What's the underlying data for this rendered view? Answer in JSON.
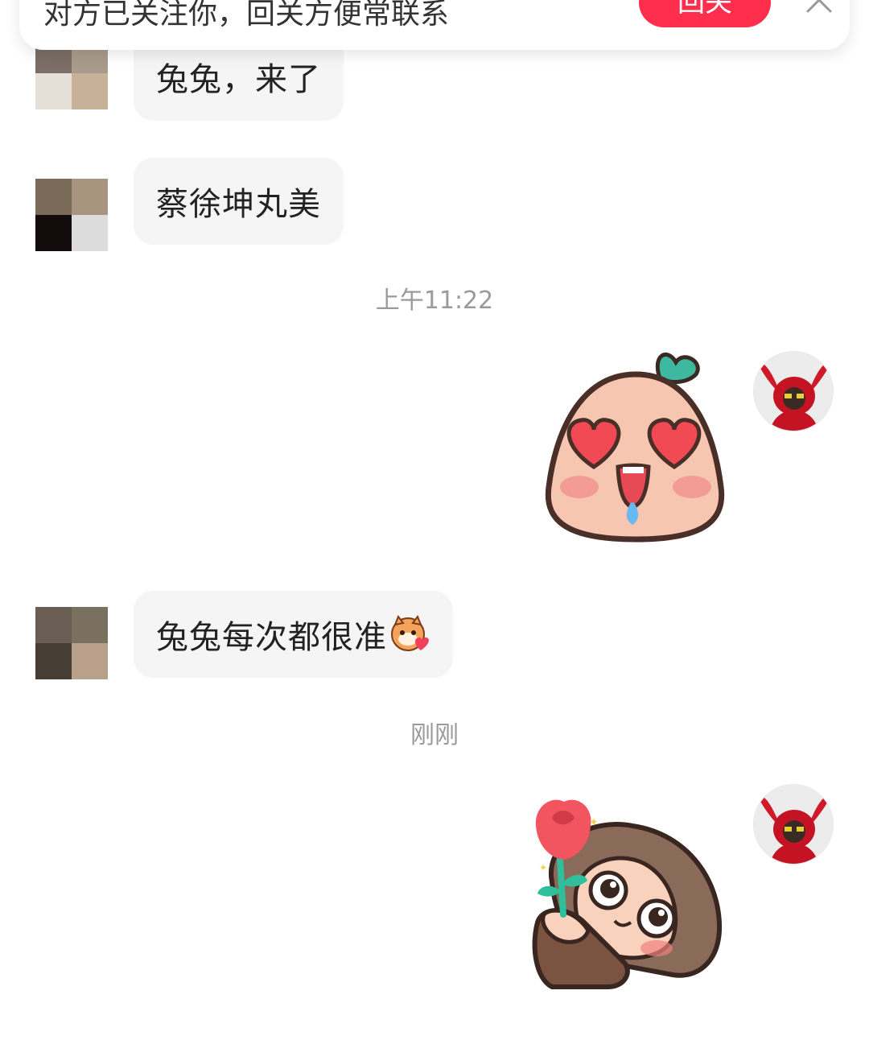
{
  "banner": {
    "text": "对方已关注你，回关方便常联系",
    "button_label": "回关",
    "close_icon": "close-icon"
  },
  "messages": [
    {
      "side": "left",
      "type": "text",
      "text": "兔兔，来了"
    },
    {
      "side": "left",
      "type": "text",
      "text": "蔡徐坤丸美"
    },
    {
      "type": "timestamp",
      "text": "上午11:22"
    },
    {
      "side": "right",
      "type": "sticker",
      "sticker": "heart-eyes-blob-sticker"
    },
    {
      "side": "left",
      "type": "text",
      "text": "兔兔每次都很准",
      "emoji": "tiger-heart-emoji"
    },
    {
      "type": "timestamp",
      "text": "刚刚"
    },
    {
      "side": "right",
      "type": "sticker",
      "sticker": "girl-with-rose-sticker"
    }
  ],
  "colors": {
    "accent": "#ff2e4d",
    "bubble_bg": "#f5f5f5",
    "timestamp": "#9a9a9a"
  }
}
